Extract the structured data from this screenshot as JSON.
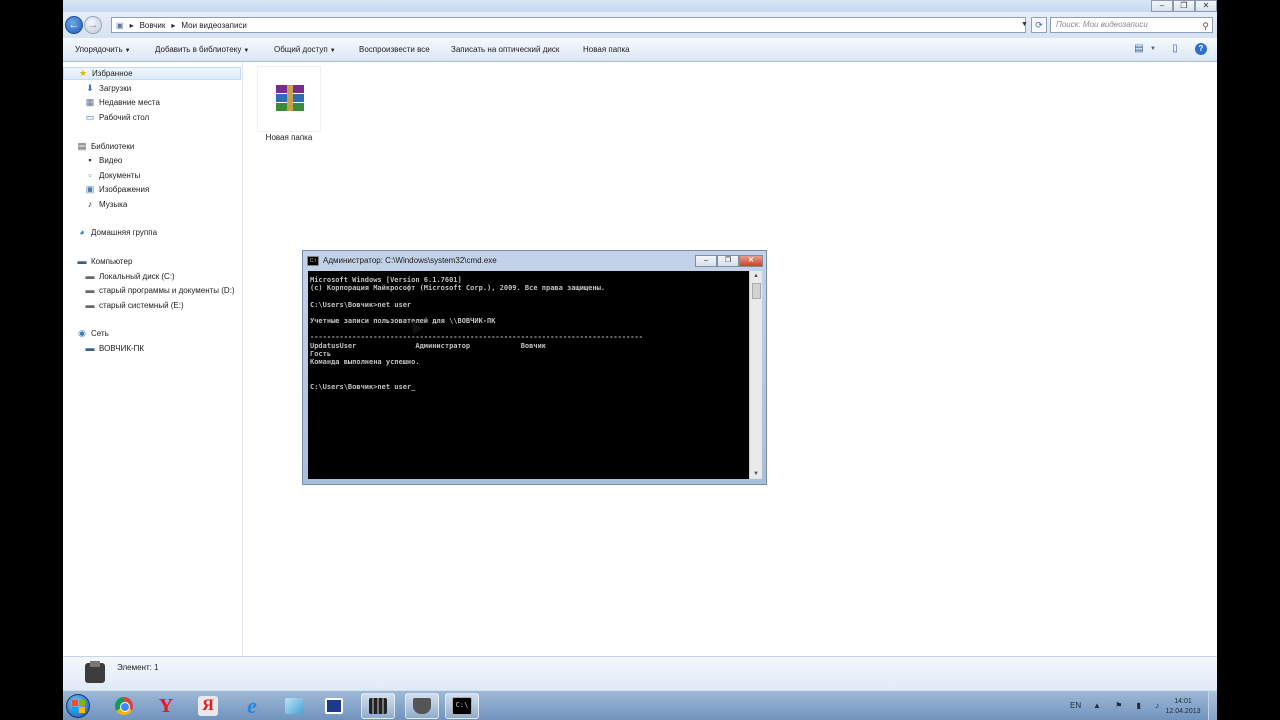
{
  "address": {
    "crumbs": [
      "Вовчик",
      "Мои видеозаписи"
    ],
    "search_placeholder": "Поиск: Мои видеозаписи"
  },
  "toolbar": {
    "organize": "Упорядочить",
    "add_library": "Добавить в библиотеку",
    "share": "Общий доступ",
    "play_all": "Воспроизвести все",
    "burn": "Записать на оптический диск",
    "new_folder": "Новая папка"
  },
  "nav": {
    "favorites": "Избранное",
    "downloads": "Загрузки",
    "recent": "Недавние места",
    "desktop": "Рабочий стол",
    "libraries": "Библиотеки",
    "video": "Видео",
    "documents": "Документы",
    "pictures": "Изображения",
    "music": "Музыка",
    "homegroup": "Домашняя группа",
    "computer": "Компьютер",
    "drive_c": "Локальный диск (C:)",
    "drive_d": "старый программы и документы (D:)",
    "drive_e": "старый системный (E:)",
    "network": "Сеть",
    "network_pc": "ВОВЧИК-ПК"
  },
  "content": {
    "file_label": "Новая папка"
  },
  "status": {
    "text": "Элемент: 1"
  },
  "cmd": {
    "title": "Администратор: C:\\Windows\\system32\\cmd.exe",
    "output": "Microsoft Windows [Version 6.1.7601]\n(c) Корпорация Майкрософт (Microsoft Corp.), 2009. Все права защищены.\n\nC:\\Users\\Вовчик>net user\n\nУчетные записи пользователей для \\\\ВОВЧИК-ПК\n\n-------------------------------------------------------------------------------\nUpdatusUser              Администратор            Вовчик\nГость\nКоманда выполнена успешно.\n\n\nC:\\Users\\Вовчик>net user_"
  },
  "taskbar": {
    "lang": "EN",
    "time": "14:01",
    "date": "12.04.2013"
  },
  "icons": {
    "start": "windows-start-icon",
    "chrome": "chrome-icon",
    "yandex": "yandex-icon",
    "yandex_browser": "yandex-browser-icon",
    "ie": "internet-explorer-icon"
  }
}
